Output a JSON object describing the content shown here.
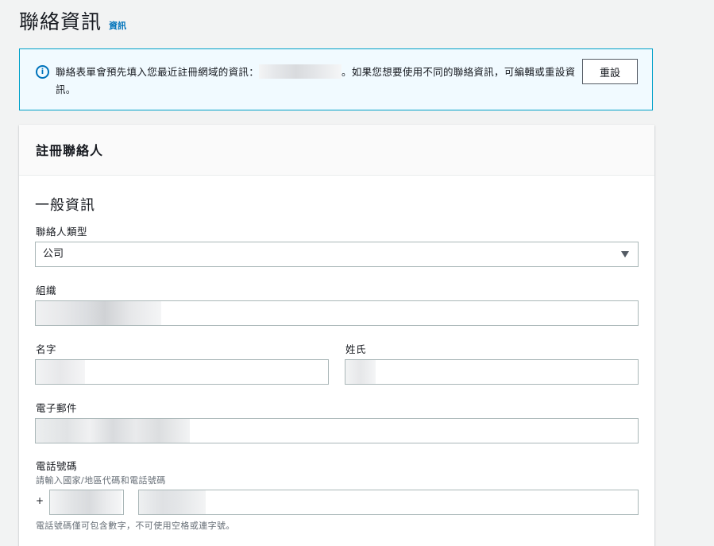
{
  "header": {
    "title": "聯絡資訊",
    "info_link": "資訊"
  },
  "alert": {
    "icon": "info-icon",
    "text_before": "聯絡表單會預先填入您最近註冊網域的資訊：",
    "text_after": "。如果您想要使用不同的聯絡資訊，可編輯或重設資訊。",
    "reset_button": "重設"
  },
  "panel": {
    "title": "註冊聯絡人",
    "section_title": "一般資訊",
    "contact_type": {
      "label": "聯絡人類型",
      "value": "公司"
    },
    "organization": {
      "label": "組織"
    },
    "first_name": {
      "label": "名字"
    },
    "last_name": {
      "label": "姓氏"
    },
    "email": {
      "label": "電子郵件"
    },
    "phone": {
      "label": "電話號碼",
      "description": "請輸入國家/地區代碼和電話號碼",
      "prefix": "+",
      "hint": "電話號碼僅可包含數字，不可使用空格或連字號。"
    }
  },
  "colors": {
    "link": "#0073bb",
    "alert_border": "#00a1c9",
    "alert_background": "#f1faff",
    "page_background": "#f2f3f3"
  }
}
